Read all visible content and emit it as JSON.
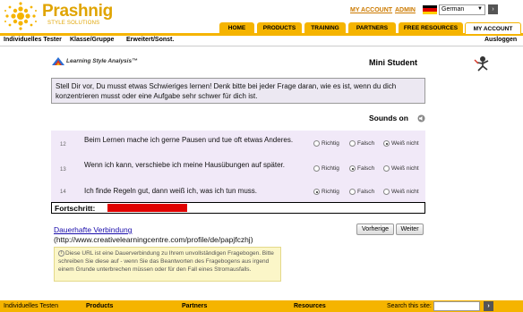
{
  "brand": {
    "name": "Prashnig",
    "tagline": "STYLE SOLUTIONS",
    "accent": "#f5b400"
  },
  "top_links": {
    "my_account": "MY ACCOUNT",
    "admin": "ADMIN"
  },
  "language": {
    "selected": "German",
    "icon": "german-flag-icon"
  },
  "nav_tabs": [
    {
      "label": "HOME"
    },
    {
      "label": "PRODUCTS"
    },
    {
      "label": "TRAINING"
    },
    {
      "label": "PARTNERS"
    },
    {
      "label": "FREE RESOURCES"
    },
    {
      "label": "MY ACCOUNT",
      "active": true
    }
  ],
  "sub_nav": [
    {
      "label": "Individuelles Tester"
    },
    {
      "label": "Klasse/Gruppe"
    },
    {
      "label": "Erweitert/Sonst."
    }
  ],
  "logout_label": "Ausloggen",
  "content": {
    "lsa_logo_text": "Learning Style Analysis™",
    "page_title": "Mini Student",
    "instructions": "Stell Dir vor, Du musst etwas Schwieriges lernen! Denk bitte bei jeder Frage daran, wie es ist, wenn du dich konzentrieren musst oder eine Aufgabe sehr schwer für dich ist.",
    "sounds_label": "Sounds on",
    "options": [
      "Richtig",
      "Falsch",
      "Weiß nicht"
    ],
    "questions": [
      {
        "number": "12",
        "text": "Beim Lernen mache ich gerne Pausen und tue oft etwas Anderes.",
        "selected": "Weiß nicht"
      },
      {
        "number": "13",
        "text": "Wenn ich kann, verschiebe ich meine Hausübungen auf später.",
        "selected": "Falsch"
      },
      {
        "number": "14",
        "text": "Ich finde Regeln gut, dann weiß ich, was ich tun muss.",
        "selected": "Richtig"
      }
    ],
    "progress_label": "Fortschritt:",
    "progress_fraction": 0.25,
    "permanent_link_label": "Dauerhafte Verbindung",
    "permanent_url": "(http://www.creativelearningcentre.com/profile/de/papjfczhj)",
    "prev_button": "Vorherige",
    "next_button": "Weiter",
    "note": "Diese URL ist eine Dauerverbindung zu Ihrem unvollständigen Fragebogen. Bitte schreiben Sie diese auf - wenn Sie das Beantworten des Fragebogens aus irgend einem Grunde unterbrechen müssen oder für den Fall eines Stromausfalls."
  },
  "footer": {
    "links": [
      "Individuelles Testen",
      "Products",
      "Partners",
      "Resources"
    ],
    "search_label": "Search this site:"
  }
}
